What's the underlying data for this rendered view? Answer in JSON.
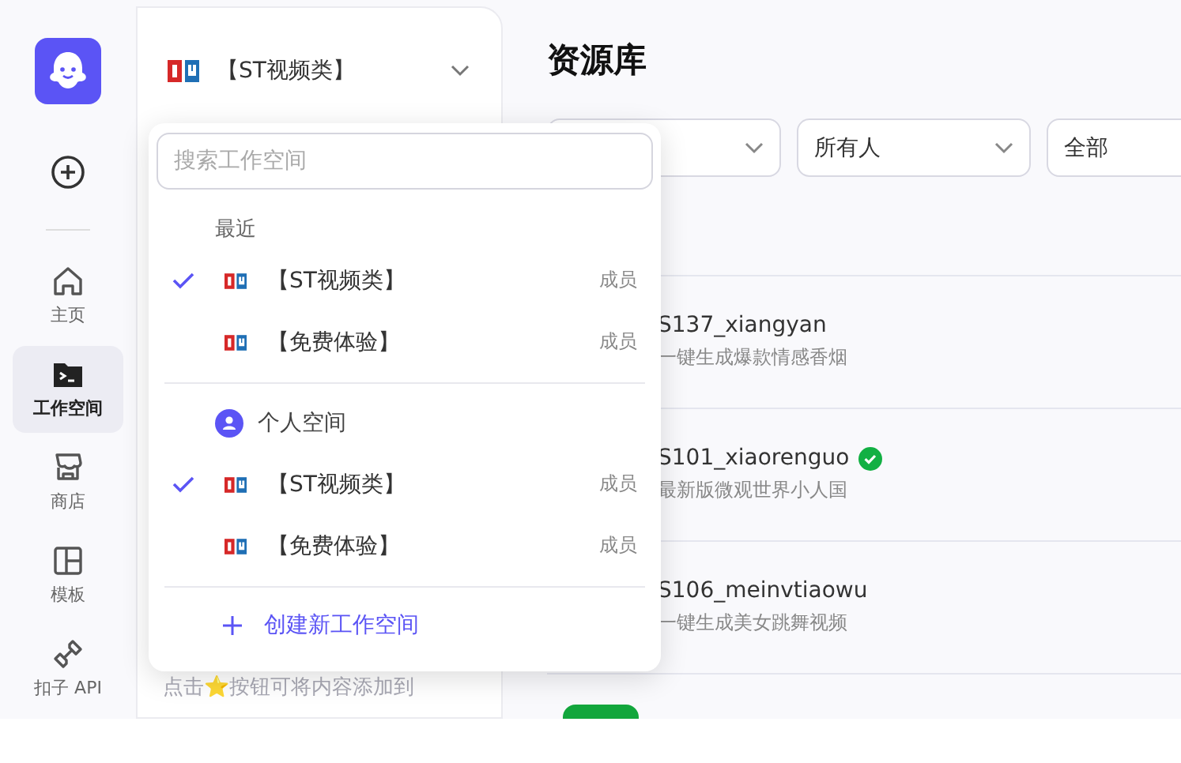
{
  "nav": {
    "items": [
      {
        "kind": "home",
        "label": "主页",
        "selected": false
      },
      {
        "kind": "workspace",
        "label": "工作空间",
        "selected": true
      },
      {
        "kind": "store",
        "label": "商店",
        "selected": false
      },
      {
        "kind": "template",
        "label": "模板",
        "selected": false
      },
      {
        "kind": "api",
        "label": "扣子 API",
        "selected": false
      }
    ]
  },
  "panel": {
    "workspace": "【ST视频类】",
    "hint": "点击⭐按钮可将内容添加到"
  },
  "main": {
    "title": "资源库",
    "filters": [
      {
        "kind": "select"
      },
      {
        "kind": "select",
        "value": "所有人"
      },
      {
        "kind": "select",
        "value": "全部"
      }
    ],
    "rows": [
      {
        "name": "S137_xiangyan",
        "description": "一键生成爆款情感香烟",
        "verified": false
      },
      {
        "name": "S101_xiaorenguo",
        "description": "最新版微观世界小人国",
        "verified": true
      },
      {
        "name": "S106_meinvtiaowu",
        "description": "一键生成美女跳舞视频",
        "verified": false
      }
    ]
  },
  "dropdown": {
    "placeholder": "搜索工作空间",
    "groups": [
      {
        "kind": "recent",
        "label": "最近",
        "items": [
          {
            "name": "【ST视频类】",
            "role": "成员",
            "selected": true
          },
          {
            "name": "【免费体验】",
            "role": "成员",
            "selected": false
          }
        ]
      },
      {
        "kind": "personal",
        "label": "个人空间",
        "items": [
          {
            "name": "【ST视频类】",
            "role": "成员",
            "selected": true
          },
          {
            "name": "【免费体验】",
            "role": "成员",
            "selected": false
          }
        ]
      }
    ],
    "create": "创建新工作空间"
  }
}
